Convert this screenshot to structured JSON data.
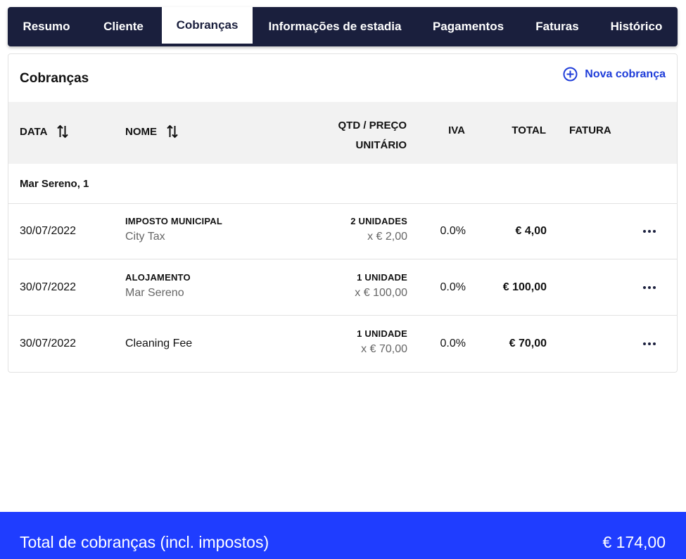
{
  "tabs": [
    {
      "label": "Resumo"
    },
    {
      "label": "Cliente"
    },
    {
      "label": "Cobranças"
    },
    {
      "label": "Informações de estadia"
    },
    {
      "label": "Pagamentos"
    },
    {
      "label": "Faturas"
    },
    {
      "label": "Histórico"
    }
  ],
  "active_tab": "Cobranças",
  "card": {
    "title": "Cobranças",
    "new_charge_label": "Nova cobrança"
  },
  "table": {
    "columns": {
      "date": "DATA",
      "name": "NOME",
      "qty_line1": "QTD / PREÇO",
      "qty_line2": "UNITÁRIO",
      "vat": "IVA",
      "total": "TOTAL",
      "invoice": "FATURA"
    },
    "group_label": "Mar Sereno, 1",
    "rows": [
      {
        "date": "30/07/2022",
        "name_main": "IMPOSTO MUNICIPAL",
        "name_sub": "City Tax",
        "qty": "2 UNIDADES",
        "unit_price": "x € 2,00",
        "vat": "0.0%",
        "total": "€ 4,00"
      },
      {
        "date": "30/07/2022",
        "name_main": "ALOJAMENTO",
        "name_sub": "Mar Sereno",
        "qty": "1 UNIDADE",
        "unit_price": "x € 100,00",
        "vat": "0.0%",
        "total": "€ 100,00"
      },
      {
        "date": "30/07/2022",
        "name_main": "Cleaning Fee",
        "name_sub": "",
        "qty": "1 UNIDADE",
        "unit_price": "x € 70,00",
        "vat": "0.0%",
        "total": "€ 70,00"
      }
    ]
  },
  "footer": {
    "label": "Total de cobranças (incl. impostos)",
    "value": "€ 174,00"
  },
  "colors": {
    "tab_bar": "#1a1f3d",
    "accent": "#1f3dd9",
    "footer": "#1f3dff"
  },
  "icons": {
    "sort": "sort-arrows-icon",
    "add": "plus-circle-icon",
    "more": "more-horizontal-icon"
  }
}
